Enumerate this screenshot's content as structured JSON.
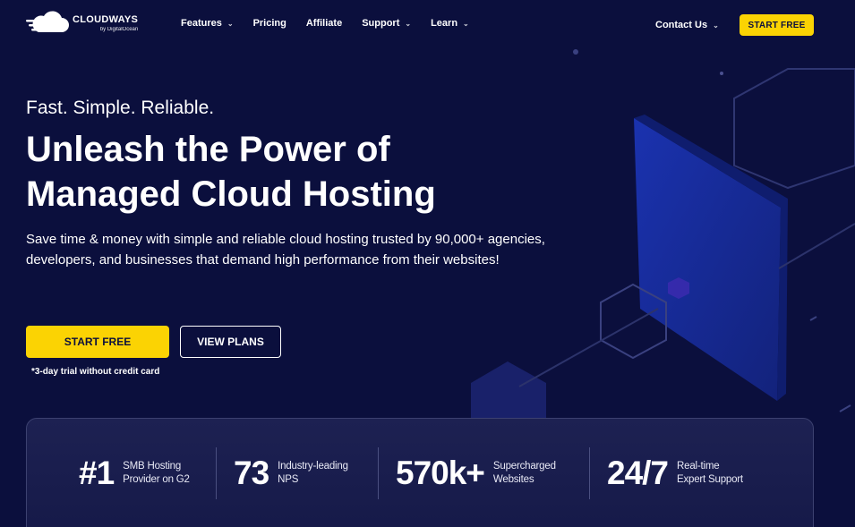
{
  "header": {
    "logo_name": "CLOUDWAYS",
    "logo_sub": "by DigitalOcean",
    "nav": [
      {
        "label": "Features",
        "has_dropdown": true
      },
      {
        "label": "Pricing",
        "has_dropdown": false
      },
      {
        "label": "Affiliate",
        "has_dropdown": false
      },
      {
        "label": "Support",
        "has_dropdown": true
      },
      {
        "label": "Learn",
        "has_dropdown": true
      }
    ],
    "contact_label": "Contact Us",
    "start_free_label": "START FREE"
  },
  "hero": {
    "tagline": "Fast. Simple. Reliable.",
    "headline": "Unleash the Power of Managed Cloud Hosting",
    "description": "Save time & money with simple and reliable cloud hosting trusted by 90,000+ agencies, developers, and businesses that demand high performance from their websites!",
    "primary_button": "START FREE",
    "secondary_button": "VIEW PLANS",
    "trial_note": "*3-day trial without credit card"
  },
  "stats": [
    {
      "value": "#1",
      "label_line1": "SMB Hosting",
      "label_line2": "Provider on G2"
    },
    {
      "value": "73",
      "label_line1": "Industry-leading",
      "label_line2": "NPS"
    },
    {
      "value": "570k+",
      "label_line1": "Supercharged",
      "label_line2": "Websites"
    },
    {
      "value": "24/7",
      "label_line1": "Real-time",
      "label_line2": "Expert Support"
    }
  ],
  "colors": {
    "background": "#0b0f3d",
    "accent": "#fbd303",
    "panel_blue": "#1a2ea8"
  },
  "icons": {
    "logo": "cloud-icon",
    "dropdown": "chevron-down-icon"
  }
}
